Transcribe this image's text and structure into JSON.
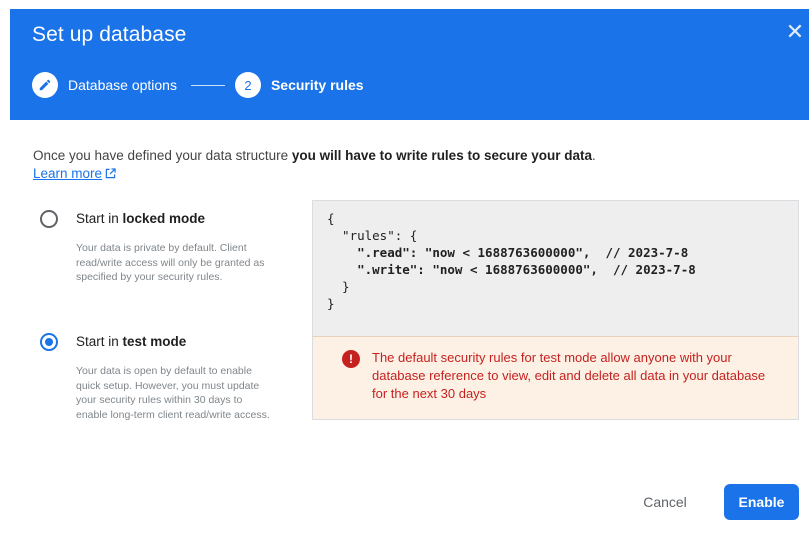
{
  "dialog": {
    "title": "Set up database",
    "close_symbol": "✕"
  },
  "stepper": {
    "steps": [
      {
        "number": "",
        "icon": "pencil-icon",
        "label": "Database options",
        "state": "completed"
      },
      {
        "number": "2",
        "label": "Security rules",
        "state": "active"
      }
    ]
  },
  "intro": {
    "text_prefix": "Once you have defined your data structure ",
    "text_bold": "you will have to write rules to secure your data",
    "text_suffix": ".",
    "learn_more": "Learn more"
  },
  "options": [
    {
      "label_prefix": "Start in ",
      "label_bold": "locked mode",
      "selected": false,
      "description": "Your data is private by default. Client read/write access will only be granted as specified by your security rules."
    },
    {
      "label_prefix": "Start in ",
      "label_bold": "test mode",
      "selected": true,
      "description": "Your data is open by default to enable quick setup. However, you must update your security rules within 30 days to enable long-term client read/write access."
    }
  ],
  "rules_code": [
    "{",
    "  \"rules\": {",
    "    \".read\": \"now < 1688763600000\",  // 2023-7-8",
    "    \".write\": \"now < 1688763600000\",  // 2023-7-8",
    "  }",
    "}"
  ],
  "warning": {
    "icon": "error-icon",
    "text": "The default security rules for test mode allow anyone with your database reference to view, edit and delete all data in your database for the next 30 days"
  },
  "actions": {
    "cancel": "Cancel",
    "enable": "Enable"
  },
  "colors": {
    "primary": "#1a73e8",
    "warning_text": "#c5221f",
    "warning_bg": "#fdf1e6",
    "code_bg": "#eeeeee"
  }
}
